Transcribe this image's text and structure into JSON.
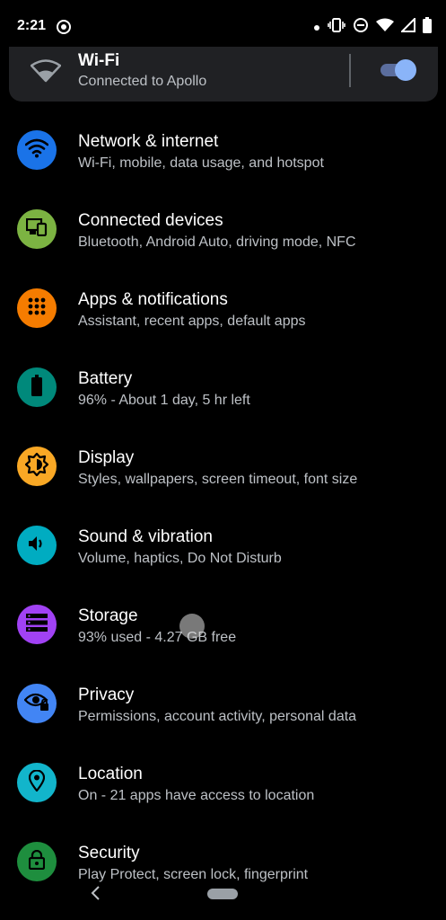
{
  "status_bar": {
    "time": "2:21"
  },
  "wifi_card": {
    "title": "Wi-Fi",
    "subtitle": "Connected to Apollo",
    "toggle_on": true
  },
  "settings": [
    {
      "title": "Network & internet",
      "subtitle": "Wi-Fi, mobile, data usage, and hotspot",
      "icon": "wifi-icon",
      "color": "#1a73e8"
    },
    {
      "title": "Connected devices",
      "subtitle": "Bluetooth, Android Auto, driving mode, NFC",
      "icon": "devices-icon",
      "color": "#7cb342"
    },
    {
      "title": "Apps & notifications",
      "subtitle": "Assistant, recent apps, default apps",
      "icon": "apps-grid-icon",
      "color": "#f57c00"
    },
    {
      "title": "Battery",
      "subtitle": "96% - About 1 day, 5 hr left",
      "icon": "battery-icon",
      "color": "#00897b"
    },
    {
      "title": "Display",
      "subtitle": "Styles, wallpapers, screen timeout, font size",
      "icon": "brightness-icon",
      "color": "#f9a825"
    },
    {
      "title": "Sound & vibration",
      "subtitle": "Volume, haptics, Do Not Disturb",
      "icon": "volume-icon",
      "color": "#00acc1"
    },
    {
      "title": "Storage",
      "subtitle": "93% used - 4.27 GB free",
      "icon": "storage-icon",
      "color": "#a142f4"
    },
    {
      "title": "Privacy",
      "subtitle": "Permissions, account activity, personal data",
      "icon": "privacy-eye-icon",
      "color": "#4285f4"
    },
    {
      "title": "Location",
      "subtitle": "On - 21 apps have access to location",
      "icon": "location-pin-icon",
      "color": "#12b5cb"
    },
    {
      "title": "Security",
      "subtitle": "Play Protect, screen lock, fingerprint",
      "icon": "lock-icon",
      "color": "#1e8e3e"
    }
  ]
}
